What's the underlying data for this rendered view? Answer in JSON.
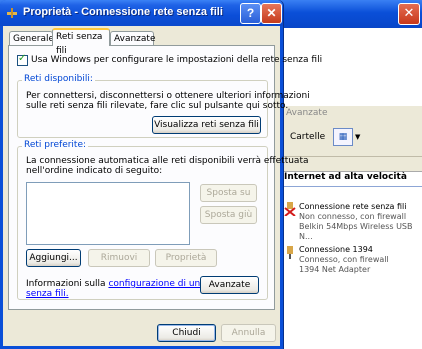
{
  "dialog": {
    "title": "Proprietà - Connessione rete senza fili",
    "tabs": [
      {
        "label": "Generale"
      },
      {
        "label": "Reti senza fili"
      },
      {
        "label": "Avanzate"
      }
    ],
    "use_windows_checkbox": {
      "label": "Usa Windows per configurare le impostazioni della rete senza fili",
      "checked": true
    },
    "available": {
      "title": "Reti disponibili:",
      "text_line1": "Per connettersi, disconnettersi o ottenere ulteriori informazioni",
      "text_line2": "sulle reti senza fili rilevate, fare clic sul pulsante qui sotto.",
      "view_button": "Visualizza reti senza fili"
    },
    "preferred": {
      "title": "Reti preferite:",
      "text_line1": "La connessione automatica alle reti disponibili verrà effettuata",
      "text_line2": "nell'ordine indicato di seguito:",
      "move_up": "Sposta su",
      "move_down": "Sposta giù",
      "add": "Aggiungi...",
      "remove": "Rimuovi",
      "properties": "Proprietà"
    },
    "info_text": "Informazioni sulla",
    "info_link1": "configurazione di una rete",
    "info_link2": "senza fili.",
    "advanced_button": "Avanzate",
    "close_button": "Chiudi",
    "cancel_button": "Annulla"
  },
  "background": {
    "menu": "Avanzate",
    "folders": "Cartelle",
    "section_title": "Internet ad alta velocità",
    "connections": [
      {
        "name": "Connessione rete senza fili",
        "status": "Non connesso, con firewall",
        "device": "Belkin 54Mbps Wireless USB N..."
      },
      {
        "name": "Connessione 1394",
        "status": "Connesso, con firewall",
        "device": "1394 Net Adapter"
      }
    ]
  }
}
